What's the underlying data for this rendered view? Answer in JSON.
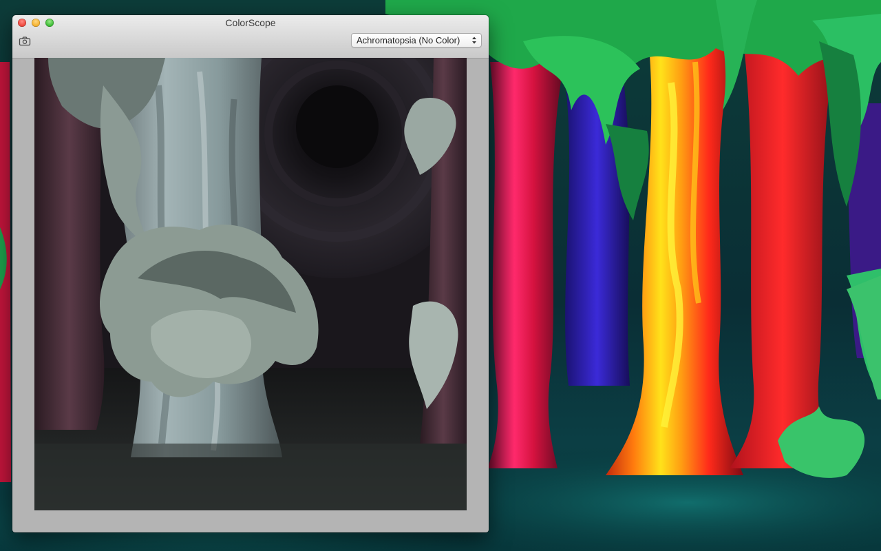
{
  "window": {
    "title": "ColorScope",
    "toolbar": {
      "camera_icon": "camera-icon",
      "mode_select": {
        "selected": "Achromatopsia (No Color)",
        "icon": "updown-arrows-icon"
      }
    }
  },
  "colors": {
    "close": "#ee4a3f",
    "minimize": "#f5b331",
    "maximize": "#3fbd37",
    "window_frame": "#b4b4b4"
  }
}
